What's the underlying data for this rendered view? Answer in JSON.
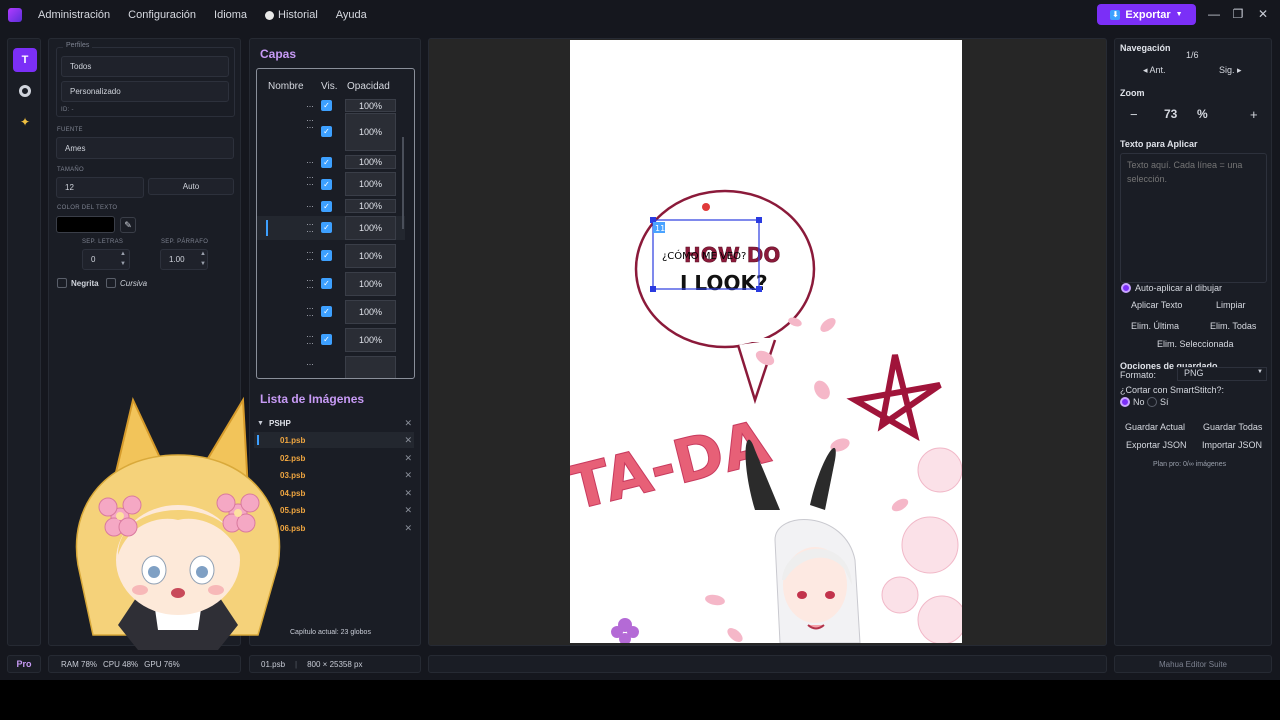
{
  "menu": {
    "items": [
      "Administración",
      "Configuración",
      "Idioma",
      "Historial",
      "Ayuda"
    ],
    "export_label": "Exportar"
  },
  "toolbar": {
    "text_tool": "T"
  },
  "props": {
    "profiles_legend": "Perfiles",
    "profile_all": "Todos",
    "profile_custom": "Personalizado",
    "id_label": "ID: -",
    "font_label": "FUENTE",
    "font_value": "Ames",
    "size_label": "TAMAÑO",
    "size_value": "12",
    "size_auto": "Auto",
    "color_label": "COLOR DEL TEXTO",
    "letter_spacing_label": "SEP. LETRAS",
    "letter_spacing_value": "0",
    "paragraph_spacing_label": "SEP. PÁRRAFO",
    "paragraph_spacing_value": "1.00",
    "bold_label": "Negrita",
    "italic_label": "Cursiva",
    "color_value": "#000000"
  },
  "layers": {
    "title": "Capas",
    "col_name": "Nombre",
    "col_vis": "Vis.",
    "col_opacity": "Opacidad",
    "opacity_values": [
      "100%",
      "100%",
      "100%",
      "100%",
      "100%",
      "100%",
      "100%",
      "100%",
      "100%",
      "100%"
    ]
  },
  "images": {
    "title": "Lista de Imágenes",
    "group": "PSHP",
    "files": [
      "01.psb",
      "02.psb",
      "03.psb",
      "04.psb",
      "05.psb",
      "06.psb"
    ],
    "chapter_info": "Capítulo actual: 23 globos"
  },
  "canvas": {
    "bubble_overlay_text": "¿CÓMO ME VEO?",
    "bubble_original_line1": "HOW DO",
    "bubble_original_line2": "I LOOK?",
    "box_index": "11",
    "sfx_text": "TA-DA"
  },
  "right": {
    "nav_title": "Navegación",
    "page_counter": "1/6",
    "prev": "◂ Ant.",
    "next": "Sig. ▸",
    "zoom_title": "Zoom",
    "zoom_minus": "−",
    "zoom_value": "73",
    "zoom_unit": "%",
    "zoom_plus": "+",
    "apply_title": "Texto para Aplicar",
    "apply_placeholder": "Texto aquí. Cada línea = una selección.",
    "auto_apply": "Auto-aplicar al dibujar",
    "apply_btn": "Aplicar Texto",
    "clear_btn": "Limpiar",
    "del_last": "Elim. Última",
    "del_all": "Elim. Todas",
    "del_selected": "Elim. Seleccionada",
    "save_title": "Opciones de guardado",
    "format_label": "Formato:",
    "format_value": "PNG",
    "smartstitch_label": "¿Cortar con SmartStitch?:",
    "opt_no": "No",
    "opt_yes": "Sí",
    "save_current": "Guardar Actual",
    "save_all": "Guardar Todas",
    "export_json": "Exportar JSON",
    "import_json": "Importar JSON",
    "plan": "Plan pro: 0/∞ imágenes"
  },
  "status": {
    "plan_badge": "Pro",
    "ram": "RAM 78%",
    "cpu": "CPU 48%",
    "gpu": "GPU 76%",
    "file": "01.psb",
    "dims": "800 × 25358 px",
    "brand": "Mahua Editor Suite"
  }
}
